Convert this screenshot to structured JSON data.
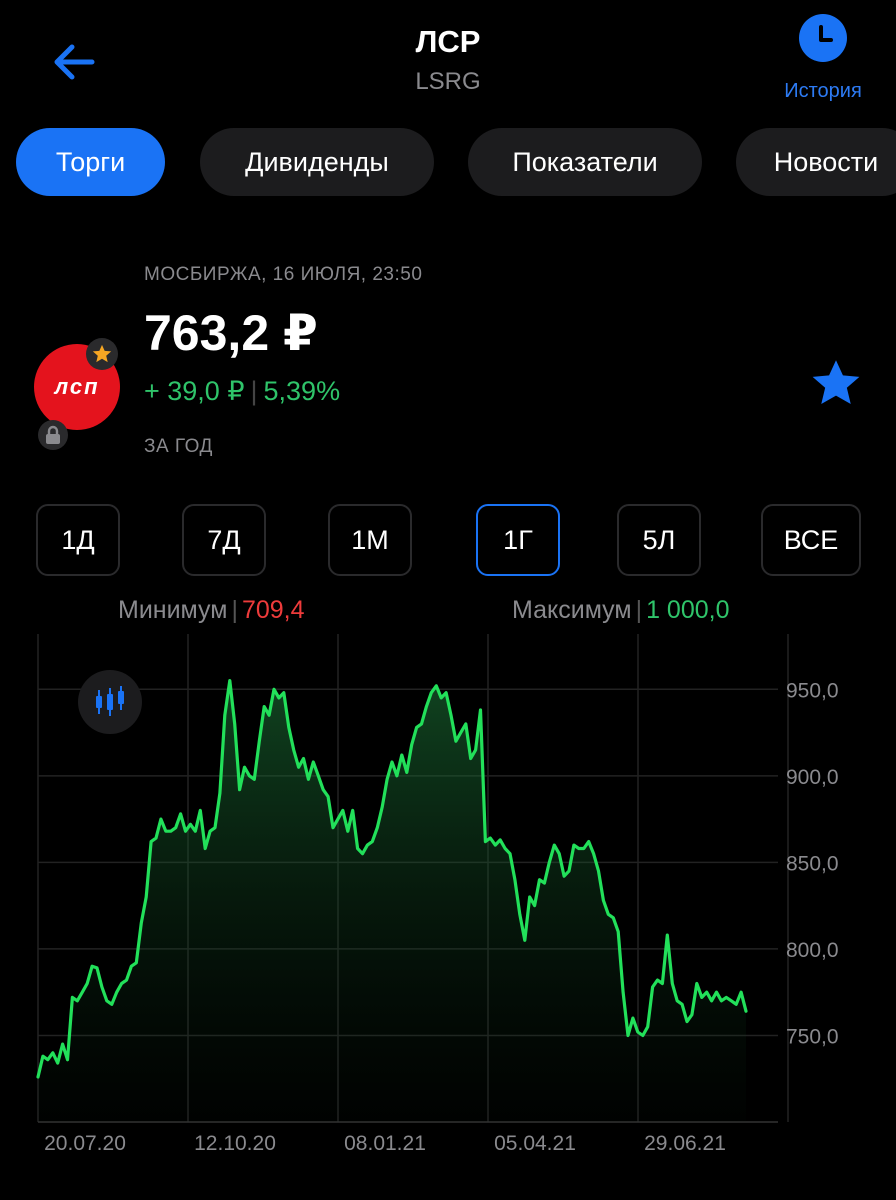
{
  "header": {
    "title": "ЛСР",
    "ticker": "LSRG",
    "history_label": "История"
  },
  "tabs": [
    "Торги",
    "Дивиденды",
    "Показатели",
    "Новости"
  ],
  "quote": {
    "exchange_time": "МОСБИРЖА, 16 ИЮЛЯ, 23:50",
    "price": "763,2 ₽",
    "change_abs": "+ 39,0 ₽",
    "change_pct": "5,39%",
    "period_label": "ЗА ГОД",
    "logo_text": "лсп"
  },
  "periods": [
    "1Д",
    "7Д",
    "1М",
    "1Г",
    "5Л",
    "ВСЕ"
  ],
  "selected_period": "1Г",
  "stats": {
    "min_label": "Минимум",
    "min_value": "709,4",
    "max_label": "Максимум",
    "max_value": "1 000,0"
  },
  "colors": {
    "accent": "#1a73f5",
    "positive": "#2fc46a",
    "negative": "#ee3b3b",
    "line": "#22e05a"
  },
  "chart_data": {
    "type": "line",
    "ylim": [
      700,
      975
    ],
    "yticks": [
      750,
      800,
      850,
      900,
      950
    ],
    "ytick_labels": [
      "750,0",
      "800,0",
      "850,0",
      "900,0",
      "950,0"
    ],
    "xtick_labels": [
      "20.07.20",
      "12.10.20",
      "08.01.21",
      "05.04.21",
      "29.06.21"
    ],
    "grid": true,
    "values": [
      726,
      738,
      736,
      740,
      734,
      745,
      736,
      772,
      770,
      775,
      780,
      790,
      789,
      778,
      770,
      768,
      775,
      780,
      782,
      790,
      792,
      815,
      830,
      862,
      864,
      875,
      868,
      868,
      870,
      878,
      868,
      872,
      868,
      880,
      858,
      868,
      870,
      890,
      935,
      955,
      930,
      892,
      905,
      900,
      898,
      920,
      940,
      935,
      950,
      945,
      948,
      928,
      915,
      905,
      910,
      898,
      908,
      900,
      892,
      888,
      870,
      875,
      880,
      868,
      880,
      858,
      855,
      860,
      862,
      870,
      882,
      898,
      908,
      900,
      912,
      902,
      918,
      928,
      930,
      940,
      948,
      952,
      945,
      948,
      935,
      920,
      925,
      930,
      910,
      915,
      938,
      862,
      864,
      860,
      863,
      858,
      855,
      840,
      820,
      805,
      830,
      825,
      840,
      838,
      850,
      860,
      855,
      842,
      845,
      860,
      858,
      858,
      862,
      855,
      845,
      828,
      820,
      818,
      810,
      775,
      750,
      760,
      752,
      750,
      755,
      778,
      782,
      780,
      808,
      780,
      770,
      768,
      758,
      762,
      780,
      772,
      775,
      770,
      775,
      770,
      772,
      770,
      768,
      775,
      764
    ]
  },
  "icons": {
    "back": "back-arrow-icon",
    "history": "clock-icon",
    "favorite": "star-icon",
    "lock": "lock-icon",
    "candles": "candlestick-icon"
  }
}
